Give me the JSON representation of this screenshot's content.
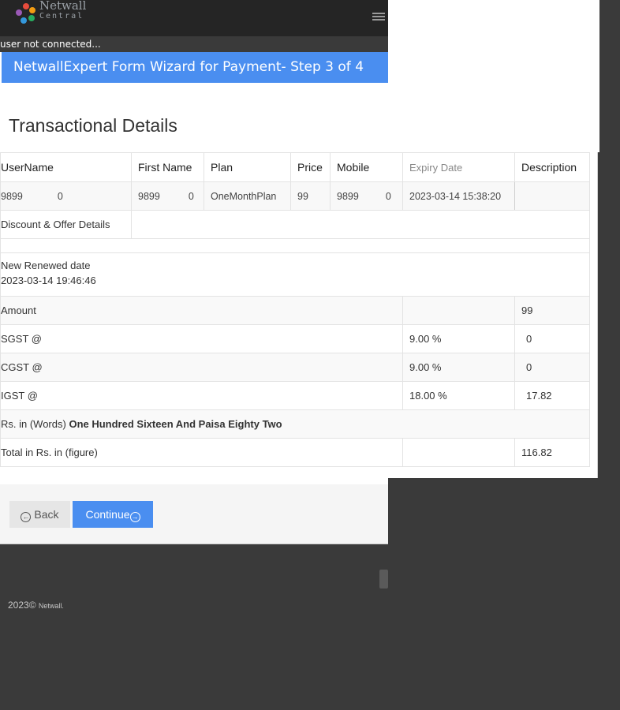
{
  "brand": {
    "name_line1": "Netwall",
    "name_line2": "Central"
  },
  "status_text": "user not connected...",
  "wizard": {
    "header": "NetwallExpert Form Wizard for Payment- Step 3 of 4"
  },
  "section_title": "Transactional Details",
  "table": {
    "headers": [
      "UserName",
      "First Name",
      "Plan",
      "Price",
      "Mobile",
      "Expiry Date",
      "Description"
    ],
    "row": {
      "username": "9899",
      "username_suffix": "0",
      "first_name": "9899",
      "first_name_suffix": "0",
      "plan": "OneMonthPlan",
      "price": "99",
      "mobile": "9899",
      "mobile_suffix": "0",
      "expiry": "2023-03-14 15:38:20",
      "description": ""
    }
  },
  "summary": {
    "discount_label": "Discount & Offer Details",
    "renew_label": "New Renewed date",
    "renew_value": "2023-03-14 19:46:46",
    "amount_label": "Amount",
    "amount_value": "99",
    "sgst_label": "SGST @",
    "sgst_rate": "9.00 %",
    "sgst_value": "0",
    "cgst_label": "CGST @",
    "cgst_rate": "9.00 %",
    "cgst_value": "0",
    "igst_label": "IGST @",
    "igst_rate": "18.00 %",
    "igst_value": "17.82",
    "words_label": "Rs. in (Words)",
    "words_value": "One Hundred Sixteen And Paisa Eighty Two",
    "total_label": "Total in Rs. in (figure)",
    "total_value": "116.82"
  },
  "buttons": {
    "back": "Back",
    "continue": "Continue"
  },
  "footer": {
    "year": "2023©",
    "brand": "Netwall."
  },
  "colors": {
    "accent": "#4a8ef0",
    "topbar": "#252525",
    "background": "#3a3a3a"
  }
}
